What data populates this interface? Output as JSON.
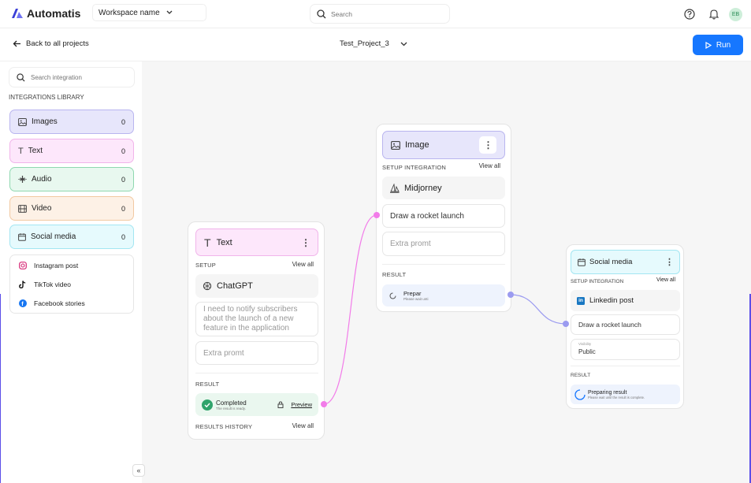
{
  "topbar": {
    "brand": "Automatis",
    "workspace": "Workspace name",
    "search_placeholder": "Search",
    "avatar_initials": "EB"
  },
  "subbar": {
    "back_label": "Back to all projects",
    "project_name": "Test_Project_3",
    "run_label": "Run"
  },
  "sidebar": {
    "search_placeholder": "Search integration",
    "library_title": "INTEGRATIONS LIBRARY",
    "items": [
      {
        "label": "Images",
        "count": "0",
        "icon": "image-icon",
        "color": "#e7e6fb",
        "border": "#b9b5ef"
      },
      {
        "label": "Text",
        "count": "0",
        "icon": "text-icon",
        "color": "#fde7fb",
        "border": "#f1b4ea"
      },
      {
        "label": "Audio",
        "count": "0",
        "icon": "audio-icon",
        "color": "#e8f8ef",
        "border": "#8fd8b0"
      },
      {
        "label": "Video",
        "count": "0",
        "icon": "video-icon",
        "color": "#fdf1e6",
        "border": "#f2c9a2"
      },
      {
        "label": "Social media",
        "count": "0",
        "icon": "calendar-icon",
        "color": "#e6fafd",
        "border": "#a3e6f2"
      }
    ],
    "social_sub": [
      {
        "label": "Instagram post",
        "icon": "instagram-icon"
      },
      {
        "label": "TikTok video",
        "icon": "tiktok-icon"
      },
      {
        "label": "Facebook stories",
        "icon": "facebook-icon"
      }
    ],
    "collapse_label": "«"
  },
  "nodes": {
    "text": {
      "title": "Text",
      "setup_label": "SETUP",
      "view_all": "View all",
      "provider": "ChatGPT",
      "prompt": "I need to notify subscribers about the launch of a new feature in the application",
      "extra_placeholder": "Extra promt",
      "result_label": "RESULT",
      "result_status": "Completed",
      "result_sub": "The result is ready.",
      "preview": "Preview",
      "history_label": "RESULTS HISTORY",
      "history_view_all": "View all"
    },
    "image": {
      "title": "Image",
      "setup_label": "SETUP INTEGRATION",
      "view_all": "View all",
      "provider": "Midjorney",
      "prompt": "Draw a rocket launch",
      "extra_placeholder": "Extra promt",
      "result_label": "RESULT",
      "result_status": "Prepar",
      "result_sub": "Please wait unti"
    },
    "social": {
      "title": "Social media",
      "setup_label": "SETUP INTEGRATION",
      "view_all": "View all",
      "provider": "Linkedin post",
      "prompt": "Draw a rocket launch",
      "visibility_label": "Visibility",
      "visibility_value": "Public",
      "result_label": "RESULT",
      "result_status": "Preparing result",
      "result_sub": "Please wait until the result is complete."
    }
  },
  "colors": {
    "accent": "#1677ff",
    "text_connector": "#f27ce9",
    "image_connector": "#9b9bf0",
    "completed": "#2fa36b"
  }
}
